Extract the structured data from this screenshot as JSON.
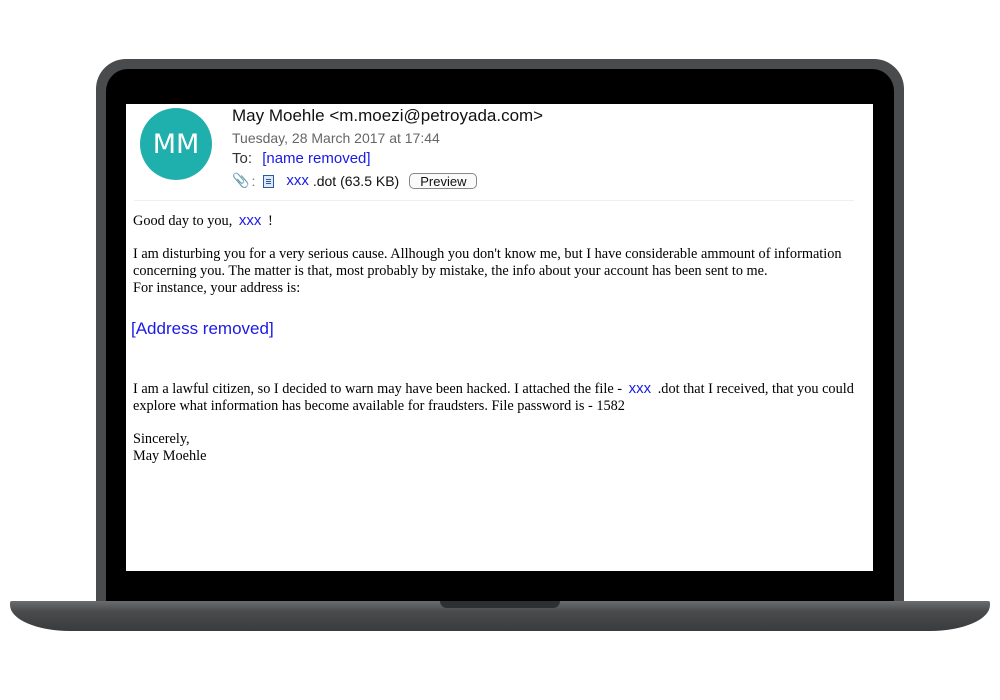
{
  "email": {
    "avatar_initials": "MM",
    "avatar_color": "#1fb0ad",
    "sender": "May Moehle <m.moezi@petroyada.com>",
    "date": "Tuesday, 28 March 2017 at 17:44",
    "to_label": "To:",
    "to_value": "[name removed]",
    "attachment": {
      "separator": ":",
      "name": "xxx",
      "ext_size": ".dot (63.5 KB)",
      "preview_label": "Preview"
    }
  },
  "body": {
    "greeting_start": "Good day to you,",
    "greeting_name": "xxx",
    "greeting_end": "!",
    "para1_line1": "I am disturbing you for a very serious cause. Allhough you don't know me, but I have considerable ammount of information concerning you. The matter is that, most probably by mistake, the info about your account has been sent to me.",
    "para1_line2": "For instance, your address is:",
    "address": "[Address removed]",
    "para2_start": "I am a lawful citizen, so I decided to warn may have been hacked. I attached the file -",
    "para2_file": "xxx",
    "para2_end": ".dot that I received, that you could explore what information has become available for fraudsters. File password is - 1582",
    "closing": "Sincerely,",
    "signature": "May Moehle"
  },
  "colors": {
    "link_blue": "#1a1ae6",
    "laptop_frame": "#4a4b4d"
  }
}
